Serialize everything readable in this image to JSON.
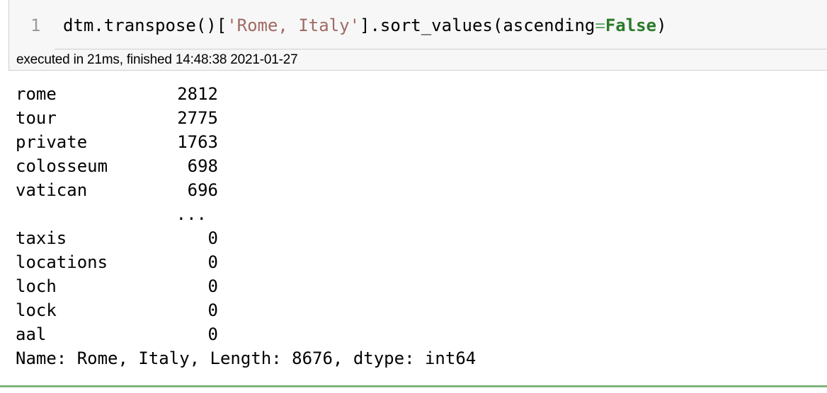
{
  "cell": {
    "line_number": "1",
    "code": {
      "prefix": "dtm.transpose()[",
      "string_arg": "'Rome, Italy'",
      "middle": "].sort_values(ascending",
      "operator": "=",
      "keyword": "False",
      "suffix": ")"
    },
    "execution_info": "executed in 21ms, finished 14:48:38 2021-01-27"
  },
  "output": {
    "top_rows": [
      {
        "label": "rome",
        "value": "2812"
      },
      {
        "label": "tour",
        "value": "2775"
      },
      {
        "label": "private",
        "value": "1763"
      },
      {
        "label": "colosseum",
        "value": "698"
      },
      {
        "label": "vatican",
        "value": "696"
      }
    ],
    "ellipsis": "...",
    "bottom_rows": [
      {
        "label": "taxis",
        "value": "0"
      },
      {
        "label": "locations",
        "value": "0"
      },
      {
        "label": "loch",
        "value": "0"
      },
      {
        "label": "lock",
        "value": "0"
      },
      {
        "label": "aal",
        "value": "0"
      }
    ],
    "summary": "Name: Rome, Italy, Length: 8676, dtype: int64"
  },
  "colors": {
    "string": "#a06a62",
    "keyword": "#2a7a2a",
    "operator": "#66aa66",
    "cell_border": "#cfcfcf",
    "input_background": "#f7f7f7",
    "selected_cell_rule": "#7fb47f"
  }
}
